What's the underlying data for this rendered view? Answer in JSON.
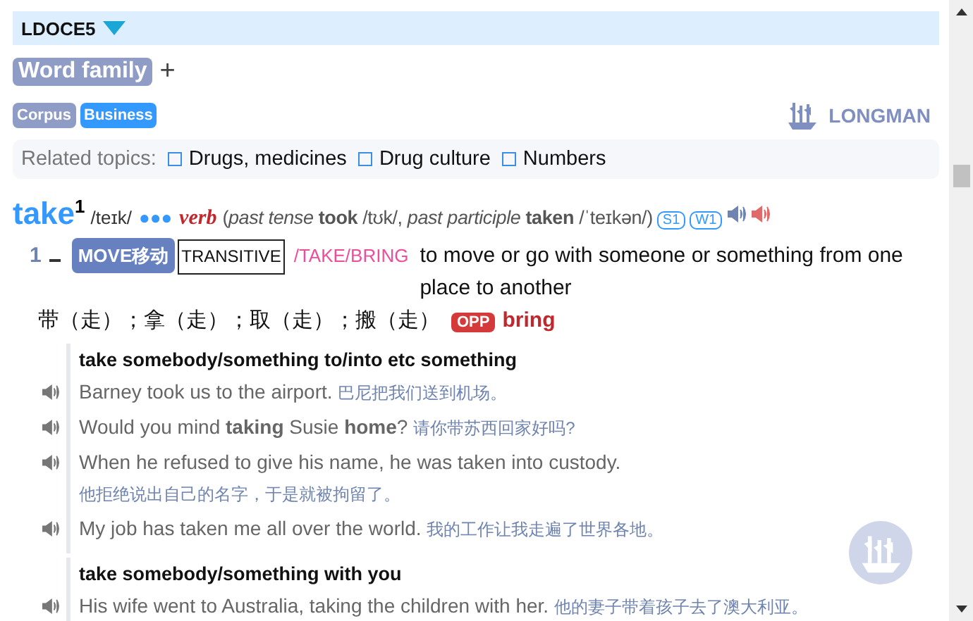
{
  "dictionary": {
    "name": "LDOCE5",
    "expanded": true
  },
  "word_family": {
    "label": "Word family",
    "toggle": "+"
  },
  "tags": [
    {
      "label": "Corpus",
      "color": "#8f9cc5"
    },
    {
      "label": "Business",
      "color": "#3399ff"
    }
  ],
  "brand": "LONGMAN",
  "related_topics": {
    "label": "Related topics:",
    "items": [
      "Drugs, medicines",
      "Drug culture",
      "Numbers"
    ]
  },
  "entry": {
    "headword": "take",
    "homnum": "1",
    "pron": "/teɪk/",
    "frequency": "●●●",
    "pos": "verb",
    "inflections": "(*past tense* **took** /tʊk/, *past participle* **taken** /ˈteɪkən/)",
    "badges": [
      "S1",
      "W1"
    ]
  },
  "sense": {
    "number": "1",
    "signpost": "MOVE移动",
    "grammar": "TRANSITIVE",
    "topic": "/TAKE/BRING",
    "definition": "to move or go with someone or something from one place to another",
    "translation": "带（走）；拿（走）；取（走）；搬（走）",
    "opp_label": "OPP",
    "opp_word": "bring"
  },
  "groups": [
    {
      "pattern": "take somebody/something to/into etc something",
      "examples": [
        {
          "en": "Barney took us to the airport.",
          "zh": "巴尼把我们送到机场。"
        },
        {
          "en": "Would you mind **taking** Susie **home**?",
          "zh": "请你带苏西回家好吗?"
        },
        {
          "en": "When he refused to give his name, he was taken into custody.",
          "zh": "他拒绝说出自己的名字，于是就被拘留了。"
        },
        {
          "en": "My job has taken me all over the world.",
          "zh": "我的工作让我走遍了世界各地。"
        }
      ]
    },
    {
      "pattern": "take somebody/something with you",
      "examples": [
        {
          "en": "His wife went to Australia, taking the children with her.",
          "zh": "他的妻子带着孩子去了澳大利亚。"
        }
      ]
    }
  ]
}
